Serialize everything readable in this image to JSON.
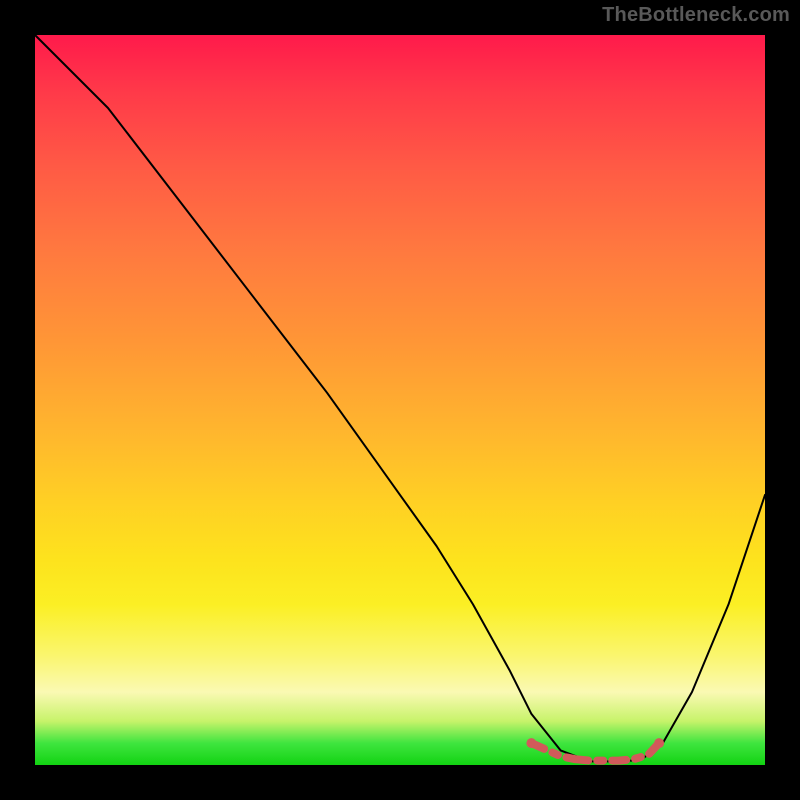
{
  "watermark": "TheBottleneck.com",
  "colors": {
    "background": "#000000",
    "gradient_top": "#ff1a4b",
    "gradient_mid": "#ffd024",
    "gradient_bottom": "#12d312",
    "curve": "#000000",
    "marker": "#d15a5a",
    "watermark_text": "#595959"
  },
  "chart_data": {
    "type": "line",
    "title": "",
    "xlabel": "",
    "ylabel": "",
    "xlim": [
      0,
      100
    ],
    "ylim": [
      0,
      100
    ],
    "series": [
      {
        "name": "curve",
        "x": [
          0,
          5,
          10,
          20,
          30,
          40,
          50,
          55,
          60,
          65,
          68,
          72,
          76,
          80,
          83,
          86,
          90,
          95,
          100
        ],
        "y": [
          100,
          95,
          90,
          77,
          64,
          51,
          37,
          30,
          22,
          13,
          7,
          2,
          0.5,
          0.5,
          0.7,
          3,
          10,
          22,
          37
        ]
      }
    ],
    "optimal_zone": {
      "x": [
        68,
        72,
        74,
        76,
        78,
        80,
        82,
        84,
        85.5
      ],
      "y": [
        3.0,
        1.2,
        0.8,
        0.6,
        0.6,
        0.6,
        0.8,
        1.4,
        3.0
      ]
    },
    "annotations": []
  }
}
